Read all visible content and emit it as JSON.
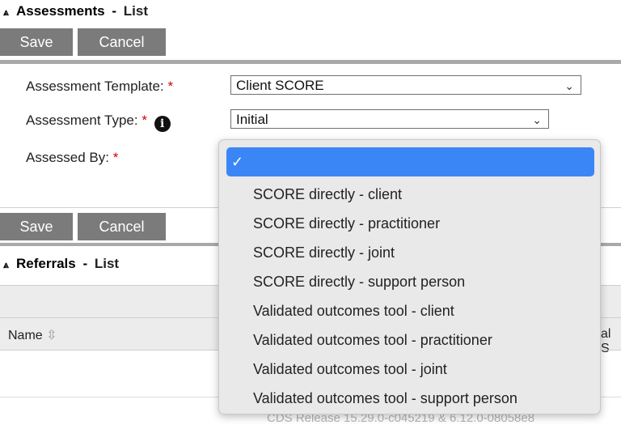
{
  "assessments": {
    "chevron": "⩓",
    "title": "Assessments",
    "sep": "-",
    "list_link": "List"
  },
  "top_buttons": {
    "save": "Save",
    "cancel": "Cancel"
  },
  "form": {
    "template_label": "Assessment Template:",
    "template_value": "Client SCORE",
    "type_label": "Assessment Type:",
    "type_value": "Initial",
    "assessed_by_label": "Assessed By:",
    "required_mark": "*",
    "info_glyph": "i"
  },
  "bottom_buttons": {
    "save": "Save",
    "cancel": "Cancel"
  },
  "referrals": {
    "chevron": "⩓",
    "title": "Referrals",
    "sep": "-",
    "list_link": "List",
    "col_name": "Name",
    "sort_glyph": "⇳",
    "col_partial": "al S"
  },
  "footer": {
    "text": "CDS Release 15.29.0-c045219 & 6.12.0-08058e8"
  },
  "dropdown": {
    "check": "✓",
    "items": [
      "SCORE directly - client",
      "SCORE directly - practitioner",
      "SCORE directly - joint",
      "SCORE directly - support person",
      "Validated outcomes tool - client",
      "Validated outcomes tool - practitioner",
      "Validated outcomes tool - joint",
      "Validated outcomes tool - support person"
    ]
  },
  "colors": {
    "button_bg": "#7b7b7b",
    "required": "#d30000",
    "highlight": "#3b86f6",
    "dropdown_bg": "#e9e9e9"
  }
}
